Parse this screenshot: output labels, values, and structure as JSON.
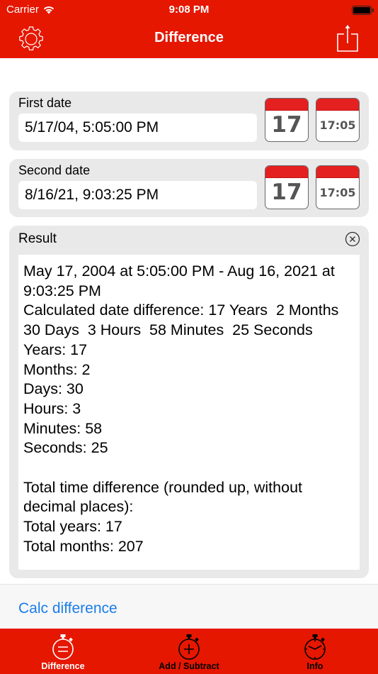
{
  "status_bar": {
    "carrier": "Carrier",
    "time": "9:08 PM"
  },
  "nav": {
    "title": "Difference",
    "left_icon": "gear-icon",
    "right_icon": "share-icon"
  },
  "first_date": {
    "label": "First date",
    "value": "5/17/04, 5:05:00 PM",
    "date_button_text": "17",
    "time_button_text": "17:05"
  },
  "second_date": {
    "label": "Second date",
    "value": "8/16/21, 9:03:25 PM",
    "date_button_text": "17",
    "time_button_text": "17:05"
  },
  "result": {
    "label": "Result",
    "clear_icon": "clear-circle-icon",
    "lines": [
      "May 17, 2004 at 5:05:00 PM - Aug 16, 2021 at 9:03:25 PM",
      "Calculated date difference: 17 Years  2 Months  30 Days  3 Hours  58 Minutes  25 Seconds",
      "Years: 17",
      "Months: 2",
      "Days: 30",
      "Hours: 3",
      "Minutes: 58",
      "Seconds: 25",
      "",
      "Total time difference (rounded up, without decimal places):",
      "Total years: 17",
      "Total months: 207"
    ]
  },
  "action": {
    "calc_label": "Calc difference"
  },
  "tabs": [
    {
      "label": "Difference",
      "icon": "stopwatch-equals-icon",
      "active": true
    },
    {
      "label": "Add / Subtract",
      "icon": "stopwatch-plus-icon",
      "active": false
    },
    {
      "label": "Info",
      "icon": "stopwatch-clock-icon",
      "active": false
    }
  ],
  "colors": {
    "brand_red": "#e51700",
    "link_blue": "#1a7dea",
    "card_gray": "#e9e9e9",
    "calendar_red": "#e52020"
  }
}
